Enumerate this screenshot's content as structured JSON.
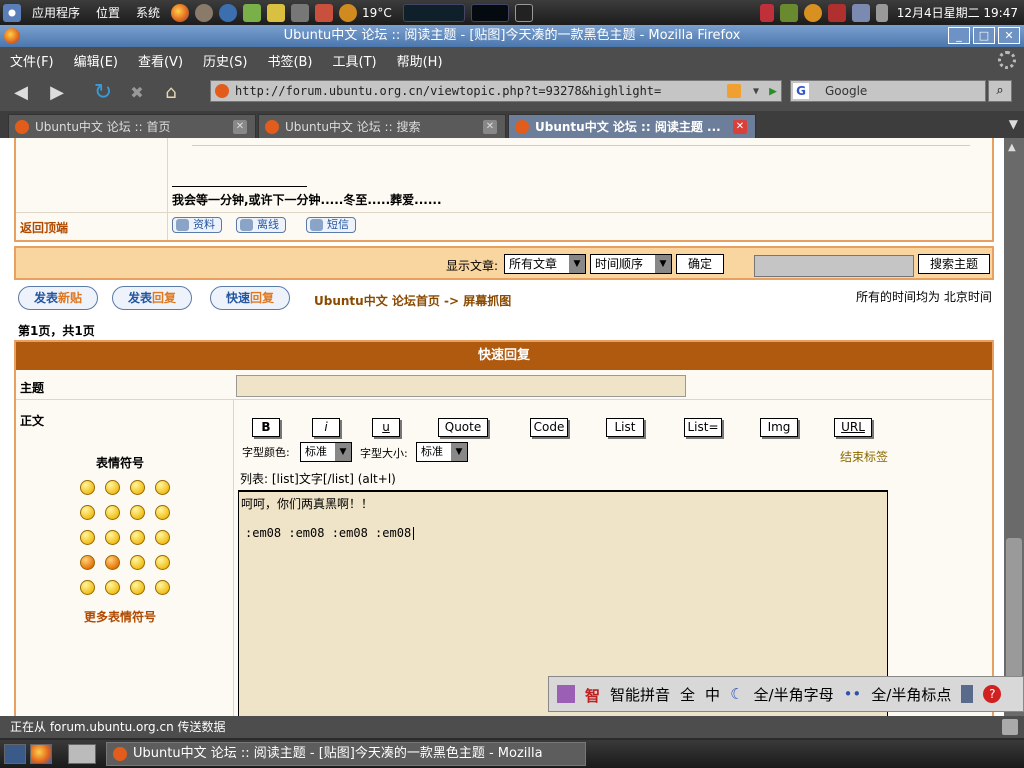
{
  "top_panel": {
    "menus": [
      "应用程序",
      "位置",
      "系统"
    ],
    "temperature": "19°C",
    "clock": "12月4日星期二 19:47"
  },
  "window": {
    "title": "Ubuntu中文 论坛 :: 阅读主题 - [贴图]今天凑的一款黑色主题 - Mozilla Firefox",
    "controls": [
      "_",
      "□",
      "✕"
    ]
  },
  "menubar": {
    "items": [
      "文件(F)",
      "编辑(E)",
      "查看(V)",
      "历史(S)",
      "书签(B)",
      "工具(T)",
      "帮助(H)"
    ]
  },
  "navbar": {
    "url": "http://forum.ubuntu.org.cn/viewtopic.php?t=93278&highlight=",
    "search_placeholder": "Google"
  },
  "tabs": [
    {
      "label": "Ubuntu中文 论坛 :: 首页",
      "active": false
    },
    {
      "label": "Ubuntu中文 论坛 :: 搜索",
      "active": false
    },
    {
      "label": "Ubuntu中文 论坛 :: 阅读主题 ...",
      "active": true
    }
  ],
  "post": {
    "signature": "我会等一分钟,或许下一分钟.....冬至.....葬爱......",
    "back_to_top": "返回顶端",
    "buttons": [
      "资料",
      "离线",
      "短信"
    ]
  },
  "filter": {
    "label": "显示文章:",
    "select1": "所有文章",
    "select2": "时间顺序",
    "confirm": "确定",
    "search_btn": "搜索主题"
  },
  "actions": {
    "new_topic_a": "发表",
    "new_topic_b": "新贴",
    "reply_a": "发表",
    "reply_b": "回复",
    "quick_a": "快速",
    "quick_b": "回复",
    "breadcrumb": "Ubuntu中文 论坛首页 -> 屏幕抓图",
    "timezone": "所有的时间均为 北京时间",
    "pageinfo": "第1页，共1页"
  },
  "quick_reply": {
    "header": "快速回复",
    "subject_label": "主题",
    "body_label": "正文",
    "emoticons_title": "表情符号",
    "more_emoticons": "更多表情符号",
    "tag_buttons": [
      "B",
      "i",
      "u",
      "Quote",
      "Code",
      "List",
      "List=",
      "Img",
      "URL"
    ],
    "font_color_label": "字型颜色:",
    "font_color_value": "标准",
    "font_size_label": "字型大小:",
    "font_size_value": "标准",
    "close_tags": "结束标签",
    "list_hint": "列表: [list]文字[/list] (alt+l)",
    "body_line1": "呵呵，你们两真黑啊！！",
    "body_line2": ":em08 :em08 :em08 :em08"
  },
  "ime": {
    "name": "智能拼音",
    "full": "全",
    "middle": "中",
    "width_chars": "全/半角字母",
    "width_punct": "全/半角标点"
  },
  "status": {
    "text": "正在从 forum.ubuntu.org.cn 传送数据"
  },
  "taskbar": {
    "task": "Ubuntu中文 论坛 :: 阅读主题 - [贴图]今天凑的一款黑色主题 - Mozilla Firefox"
  }
}
